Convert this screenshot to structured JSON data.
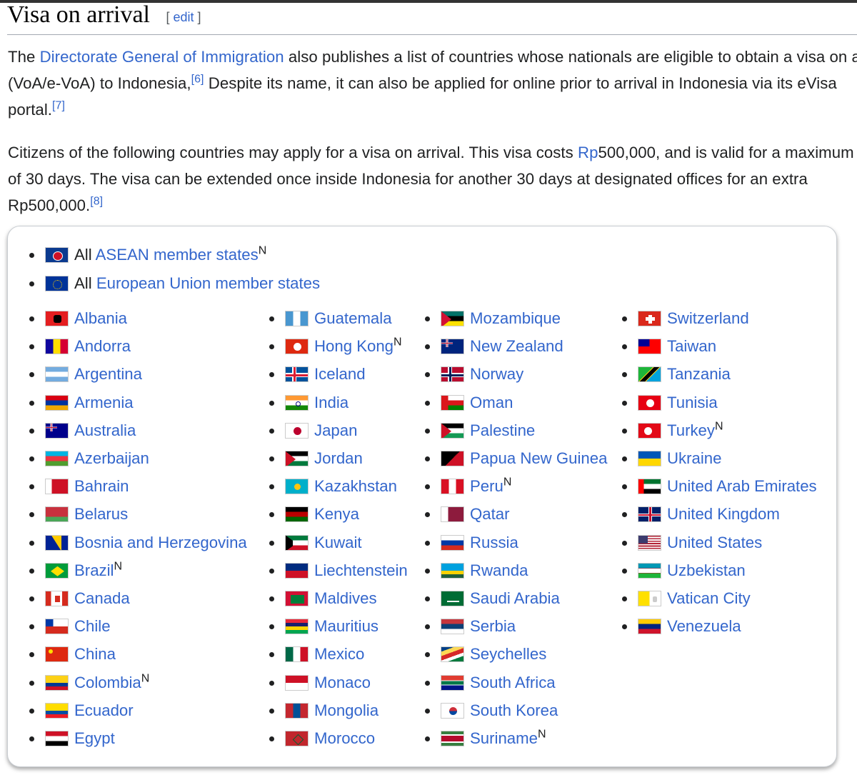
{
  "heading": {
    "title": "Visa on arrival",
    "edit_label": "edit"
  },
  "para1": {
    "t1": "The ",
    "link1": "Directorate General of Immigration",
    "t2": " also publishes a list of countries whose nationals are eligible to obtain a visa on arrival",
    "t3": "(VoA/e-VoA) to Indonesia,",
    "ref1": "[6]",
    "t4": " Despite its name, it can also be applied for online prior to arrival in Indonesia via its eVisa",
    "t5": "portal.",
    "ref2": "[7]"
  },
  "para2": {
    "t1": "Citizens of the following countries may apply for a visa on arrival. This visa costs ",
    "link1": "Rp",
    "t2": "500,000, and is valid for a maximum",
    "t3": "of 30 days. The visa can be extended once inside Indonesia for another 30 days at designated offices for an extra",
    "t4": "Rp500,000.",
    "ref1": "[8]"
  },
  "group_items": [
    {
      "prefix": "All ",
      "name": "ASEAN member states",
      "note": "N",
      "flag": "asean"
    },
    {
      "prefix": "All ",
      "name": "European Union member states",
      "note": "",
      "flag": "eu"
    }
  ],
  "columns": [
    [
      {
        "name": "Albania",
        "note": "",
        "flag": "albania"
      },
      {
        "name": "Andorra",
        "note": "",
        "flag": "andorra"
      },
      {
        "name": "Argentina",
        "note": "",
        "flag": "argentina"
      },
      {
        "name": "Armenia",
        "note": "",
        "flag": "armenia"
      },
      {
        "name": "Australia",
        "note": "",
        "flag": "australia"
      },
      {
        "name": "Azerbaijan",
        "note": "",
        "flag": "azerbaijan"
      },
      {
        "name": "Bahrain",
        "note": "",
        "flag": "bahrain"
      },
      {
        "name": "Belarus",
        "note": "",
        "flag": "belarus"
      },
      {
        "name": "Bosnia and Herzegovina",
        "note": "",
        "flag": "bosnia"
      },
      {
        "name": "Brazil",
        "note": "N",
        "flag": "brazil"
      },
      {
        "name": "Canada",
        "note": "",
        "flag": "canada"
      },
      {
        "name": "Chile",
        "note": "",
        "flag": "chile"
      },
      {
        "name": "China",
        "note": "",
        "flag": "china"
      },
      {
        "name": "Colombia",
        "note": "N",
        "flag": "colombia"
      },
      {
        "name": "Ecuador",
        "note": "",
        "flag": "ecuador"
      },
      {
        "name": "Egypt",
        "note": "",
        "flag": "egypt"
      }
    ],
    [
      {
        "name": "Guatemala",
        "note": "",
        "flag": "guatemala"
      },
      {
        "name": "Hong Kong",
        "note": "N",
        "flag": "hongkong"
      },
      {
        "name": "Iceland",
        "note": "",
        "flag": "iceland"
      },
      {
        "name": "India",
        "note": "",
        "flag": "india"
      },
      {
        "name": "Japan",
        "note": "",
        "flag": "japan"
      },
      {
        "name": "Jordan",
        "note": "",
        "flag": "jordan"
      },
      {
        "name": "Kazakhstan",
        "note": "",
        "flag": "kazakhstan"
      },
      {
        "name": "Kenya",
        "note": "",
        "flag": "kenya"
      },
      {
        "name": "Kuwait",
        "note": "",
        "flag": "kuwait"
      },
      {
        "name": "Liechtenstein",
        "note": "",
        "flag": "liechtenstein"
      },
      {
        "name": "Maldives",
        "note": "",
        "flag": "maldives"
      },
      {
        "name": "Mauritius",
        "note": "",
        "flag": "mauritius"
      },
      {
        "name": "Mexico",
        "note": "",
        "flag": "mexico"
      },
      {
        "name": "Monaco",
        "note": "",
        "flag": "monaco"
      },
      {
        "name": "Mongolia",
        "note": "",
        "flag": "mongolia"
      },
      {
        "name": "Morocco",
        "note": "",
        "flag": "morocco"
      }
    ],
    [
      {
        "name": "Mozambique",
        "note": "",
        "flag": "mozambique"
      },
      {
        "name": "New Zealand",
        "note": "",
        "flag": "newzealand"
      },
      {
        "name": "Norway",
        "note": "",
        "flag": "norway"
      },
      {
        "name": "Oman",
        "note": "",
        "flag": "oman"
      },
      {
        "name": "Palestine",
        "note": "",
        "flag": "palestine"
      },
      {
        "name": "Papua New Guinea",
        "note": "",
        "flag": "png"
      },
      {
        "name": "Peru",
        "note": "N",
        "flag": "peru"
      },
      {
        "name": "Qatar",
        "note": "",
        "flag": "qatar"
      },
      {
        "name": "Russia",
        "note": "",
        "flag": "russia"
      },
      {
        "name": "Rwanda",
        "note": "",
        "flag": "rwanda"
      },
      {
        "name": "Saudi Arabia",
        "note": "",
        "flag": "saudi"
      },
      {
        "name": "Serbia",
        "note": "",
        "flag": "serbia"
      },
      {
        "name": "Seychelles",
        "note": "",
        "flag": "seychelles"
      },
      {
        "name": "South Africa",
        "note": "",
        "flag": "southafrica"
      },
      {
        "name": "South Korea",
        "note": "",
        "flag": "southkorea"
      },
      {
        "name": "Suriname",
        "note": "N",
        "flag": "suriname"
      }
    ],
    [
      {
        "name": "Switzerland",
        "note": "",
        "flag": "switzerland"
      },
      {
        "name": "Taiwan",
        "note": "",
        "flag": "taiwan"
      },
      {
        "name": "Tanzania",
        "note": "",
        "flag": "tanzania"
      },
      {
        "name": "Tunisia",
        "note": "",
        "flag": "tunisia"
      },
      {
        "name": "Turkey",
        "note": "N",
        "flag": "turkey"
      },
      {
        "name": "Ukraine",
        "note": "",
        "flag": "ukraine"
      },
      {
        "name": "United Arab Emirates",
        "note": "",
        "flag": "uae"
      },
      {
        "name": "United Kingdom",
        "note": "",
        "flag": "uk"
      },
      {
        "name": "United States",
        "note": "",
        "flag": "us"
      },
      {
        "name": "Uzbekistan",
        "note": "",
        "flag": "uzbekistan"
      },
      {
        "name": "Vatican City",
        "note": "",
        "flag": "vatican"
      },
      {
        "name": "Venezuela",
        "note": "",
        "flag": "venezuela"
      }
    ]
  ]
}
